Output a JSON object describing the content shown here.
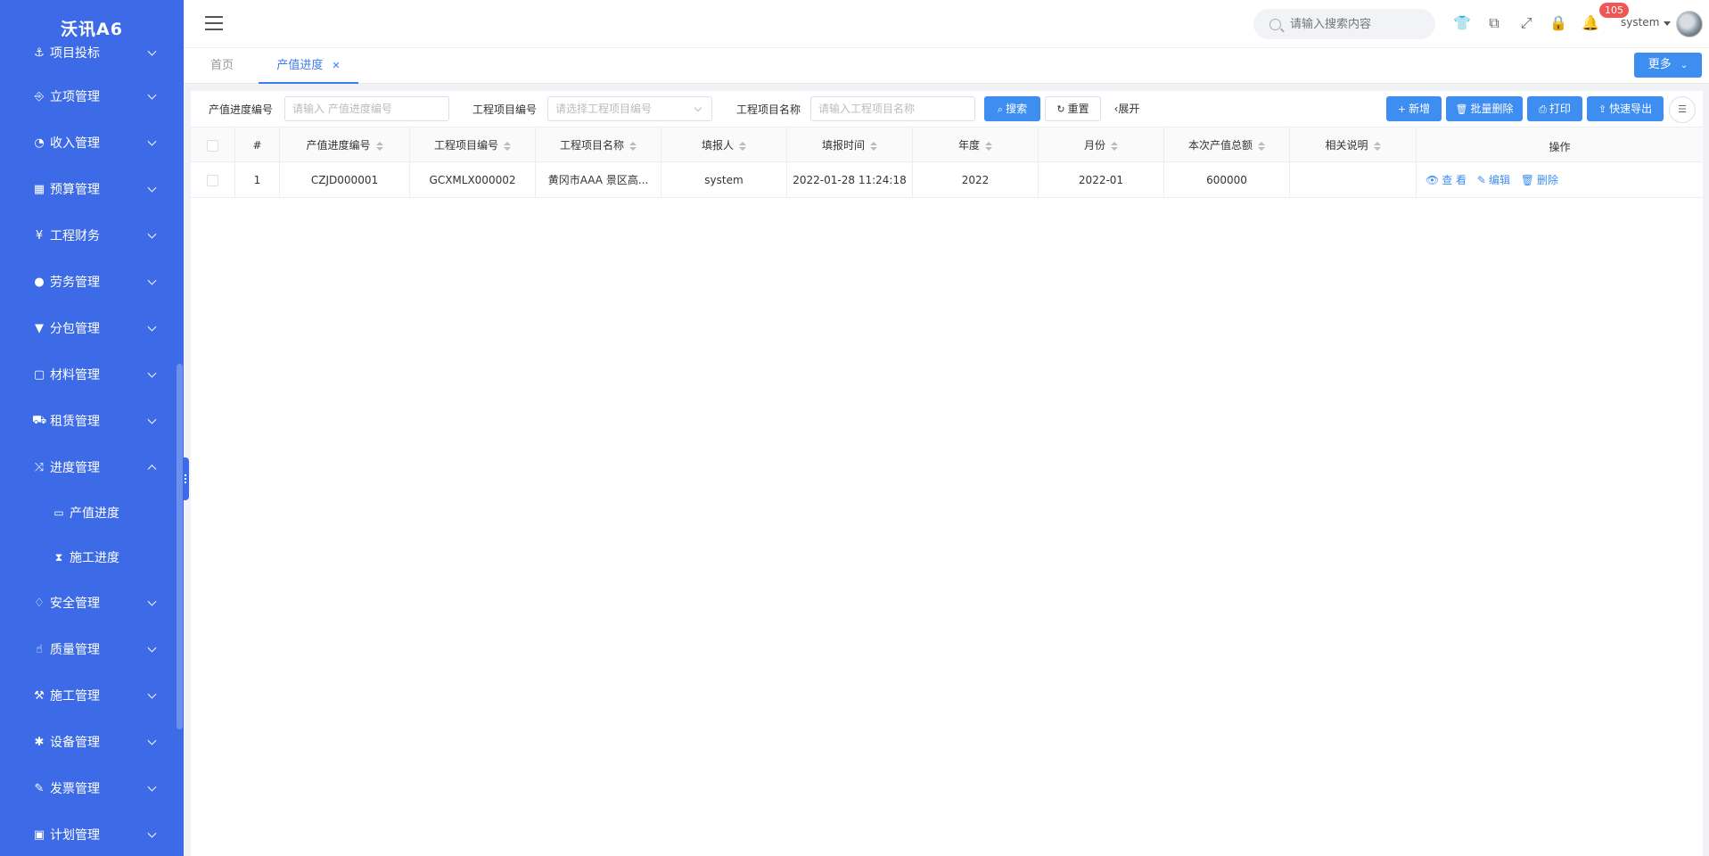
{
  "app": {
    "brand": "沃讯A6"
  },
  "sidebar": {
    "items": [
      {
        "icon": "anchor-icon",
        "glyph": "⚓",
        "label": "项目投标"
      },
      {
        "icon": "share-icon",
        "glyph": "⎆",
        "label": "立项管理"
      },
      {
        "icon": "dashboard-icon",
        "glyph": "◔",
        "label": "收入管理"
      },
      {
        "icon": "calculator-icon",
        "glyph": "▦",
        "label": "预算管理"
      },
      {
        "icon": "yen-icon",
        "glyph": "¥",
        "label": "工程财务"
      },
      {
        "icon": "user-icon",
        "glyph": "●",
        "label": "劳务管理"
      },
      {
        "icon": "filter-icon",
        "glyph": "▼",
        "label": "分包管理"
      },
      {
        "icon": "square-icon",
        "glyph": "▢",
        "label": "材料管理"
      },
      {
        "icon": "car-icon",
        "glyph": "⛟",
        "label": "租赁管理"
      },
      {
        "icon": "shuffle-icon",
        "glyph": "⤨",
        "label": "进度管理"
      }
    ],
    "sub_items": [
      {
        "icon": "battery-icon",
        "glyph": "▭",
        "label": "产值进度"
      },
      {
        "icon": "hourglass-icon",
        "glyph": "⧗",
        "label": "施工进度"
      }
    ],
    "items_after": [
      {
        "icon": "bell-icon",
        "glyph": "♢",
        "label": "安全管理"
      },
      {
        "icon": "thumbs-up-icon",
        "glyph": "☝",
        "label": "质量管理"
      },
      {
        "icon": "gavel-icon",
        "glyph": "⚒",
        "label": "施工管理"
      },
      {
        "icon": "gear-icon",
        "glyph": "✱",
        "label": "设备管理"
      },
      {
        "icon": "ticket-icon",
        "glyph": "✎",
        "label": "发票管理"
      },
      {
        "icon": "calendar-plus-icon",
        "glyph": "▣",
        "label": "计划管理"
      }
    ]
  },
  "header": {
    "search_placeholder": "请输入搜索内容",
    "notification_count": "105",
    "user_name": "system"
  },
  "tabs": {
    "home": "首页",
    "active": "产值进度",
    "more": "更多"
  },
  "filters": {
    "f1_label": "产值进度编号",
    "f1_placeholder": "请输入 产值进度编号",
    "f2_label": "工程项目编号",
    "f2_placeholder": "请选择工程项目编号",
    "f3_label": "工程项目名称",
    "f3_placeholder": "请输入工程项目名称",
    "search": "搜索",
    "reset": "重置",
    "expand": "展开"
  },
  "toolbar": {
    "add": "新增",
    "batch_delete": "批量删除",
    "print": "打印",
    "export": "快速导出"
  },
  "table": {
    "headers": [
      "#",
      "产值进度编号",
      "工程项目编号",
      "工程项目名称",
      "填报人",
      "填报时间",
      "年度",
      "月份",
      "本次产值总额",
      "相关说明",
      "操作"
    ],
    "rows": [
      {
        "index": "1",
        "code": "CZJD000001",
        "project_code": "GCXMLX000002",
        "project_name": "黄冈市AAA 景区高...",
        "reporter": "system",
        "report_time": "2022-01-28 11:24:18",
        "year": "2022",
        "month": "2022-01",
        "amount": "600000",
        "note": ""
      }
    ],
    "actions": {
      "view": "查 看",
      "edit": "编辑",
      "delete": "删除"
    }
  },
  "colors": {
    "sidebar": "#3d6be8",
    "primary": "#3d8ef0",
    "badge": "#f05656"
  }
}
